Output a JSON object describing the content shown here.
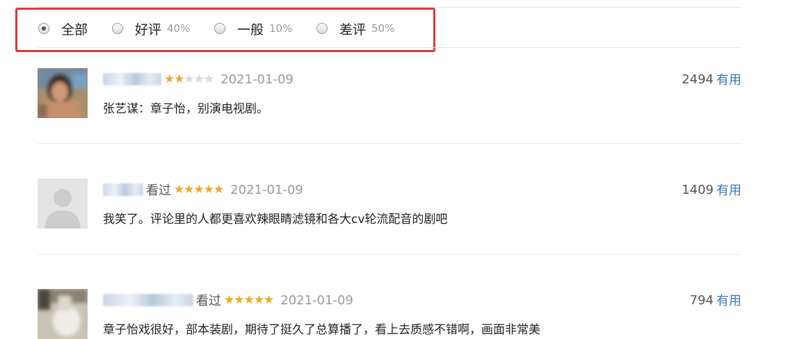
{
  "filter": {
    "options": [
      {
        "label": "全部",
        "percent": ""
      },
      {
        "label": "好评",
        "percent": "40%"
      },
      {
        "label": "一般",
        "percent": "10%"
      },
      {
        "label": "差评",
        "percent": "50%"
      }
    ],
    "selected": "全部"
  },
  "reviews": [
    {
      "status": "",
      "rating": 2,
      "date": "2021-01-09",
      "content": "张艺谋：章子怡，别演电视剧。",
      "useful_count": "2494",
      "useful_label": "有用"
    },
    {
      "status": "看过",
      "rating": 5,
      "date": "2021-01-09",
      "content": "我笑了。评论里的人都更喜欢辣眼睛滤镜和各大cv轮流配音的剧吧",
      "useful_count": "1409",
      "useful_label": "有用"
    },
    {
      "status": "看过",
      "rating": 5,
      "date": "2021-01-09",
      "content": "章子怡戏很好，部本装剧，期待了挺久了总算播了，看上去质感不错啊，画面非常美",
      "useful_count": "794",
      "useful_label": "有用"
    }
  ],
  "colors": {
    "highlight_border": "#d9383a",
    "star": "#f6a623",
    "link": "#3a77b6"
  }
}
